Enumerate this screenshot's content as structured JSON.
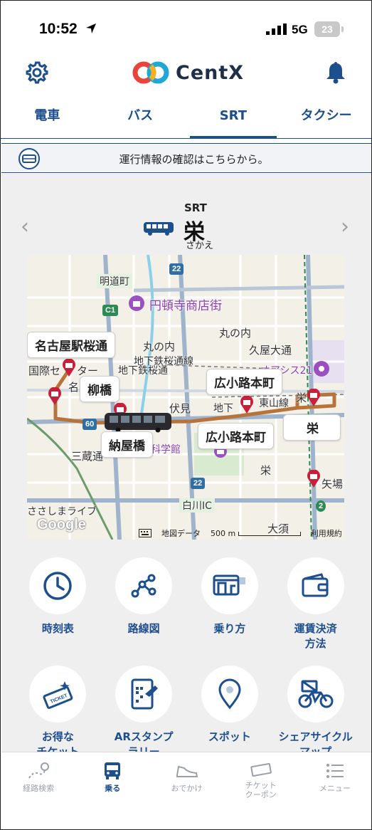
{
  "status": {
    "time": "10:52",
    "network": "5G",
    "battery": "23"
  },
  "header": {
    "brand": "CentX"
  },
  "tabs": [
    "電車",
    "バス",
    "SRT",
    "タクシー"
  ],
  "notice": {
    "text": "運行情報の確認はこちらから。"
  },
  "station": {
    "line": "SRT",
    "name": "栄",
    "kana": "さかえ"
  },
  "map": {
    "callouts": [
      "名古屋駅桜通",
      "柳橋",
      "納屋橋",
      "広小路本町",
      "広小路本町",
      "栄"
    ],
    "labels": [
      "明道町",
      "円頓寺商店街",
      "丸の内",
      "丸の内",
      "地下鉄桜通線",
      "久屋大通",
      "国際セ",
      "ター",
      "地下鉄桜通",
      "名",
      "駅",
      "伏見",
      "地下",
      "東山線",
      "栄",
      "三蔵通",
      "栄",
      "矢場",
      "白川IC",
      "ささしまライブ",
      "大須",
      "オアシス21",
      "名古屋市科学館"
    ],
    "badges": [
      "22",
      "C1",
      "22",
      "60",
      "2"
    ],
    "logo": "Google",
    "footer": {
      "attribution": "地図データ",
      "scale": "500 m",
      "terms": "利用規約"
    }
  },
  "menu": [
    {
      "label": "時刻表",
      "icon": "clock-icon"
    },
    {
      "label": "路線図",
      "icon": "route-map-icon"
    },
    {
      "label": "乗り方",
      "icon": "bus-boarding-icon"
    },
    {
      "label": "運賃決済\n方法",
      "icon": "wallet-icon"
    },
    {
      "label": "お得な\nチケット",
      "icon": "ticket-icon"
    },
    {
      "label": "ARスタンプ\nラリー",
      "icon": "ar-stamp-icon"
    },
    {
      "label": "スポット",
      "icon": "map-pin-icon"
    },
    {
      "label": "シェアサイクル\nマップ",
      "icon": "bicycle-icon"
    }
  ],
  "bottom_nav": [
    {
      "label": "経路検索",
      "icon": "route-search-icon"
    },
    {
      "label": "乗る",
      "icon": "bus-icon",
      "active": true
    },
    {
      "label": "おでかけ",
      "icon": "sneaker-icon"
    },
    {
      "label": "チケット\nクーポン",
      "icon": "ticket-coupon-icon"
    },
    {
      "label": "メニュー",
      "icon": "menu-icon"
    }
  ],
  "colors": {
    "primary": "#1d4f8f",
    "route": "#b8733a",
    "stop": "#c8203a"
  }
}
